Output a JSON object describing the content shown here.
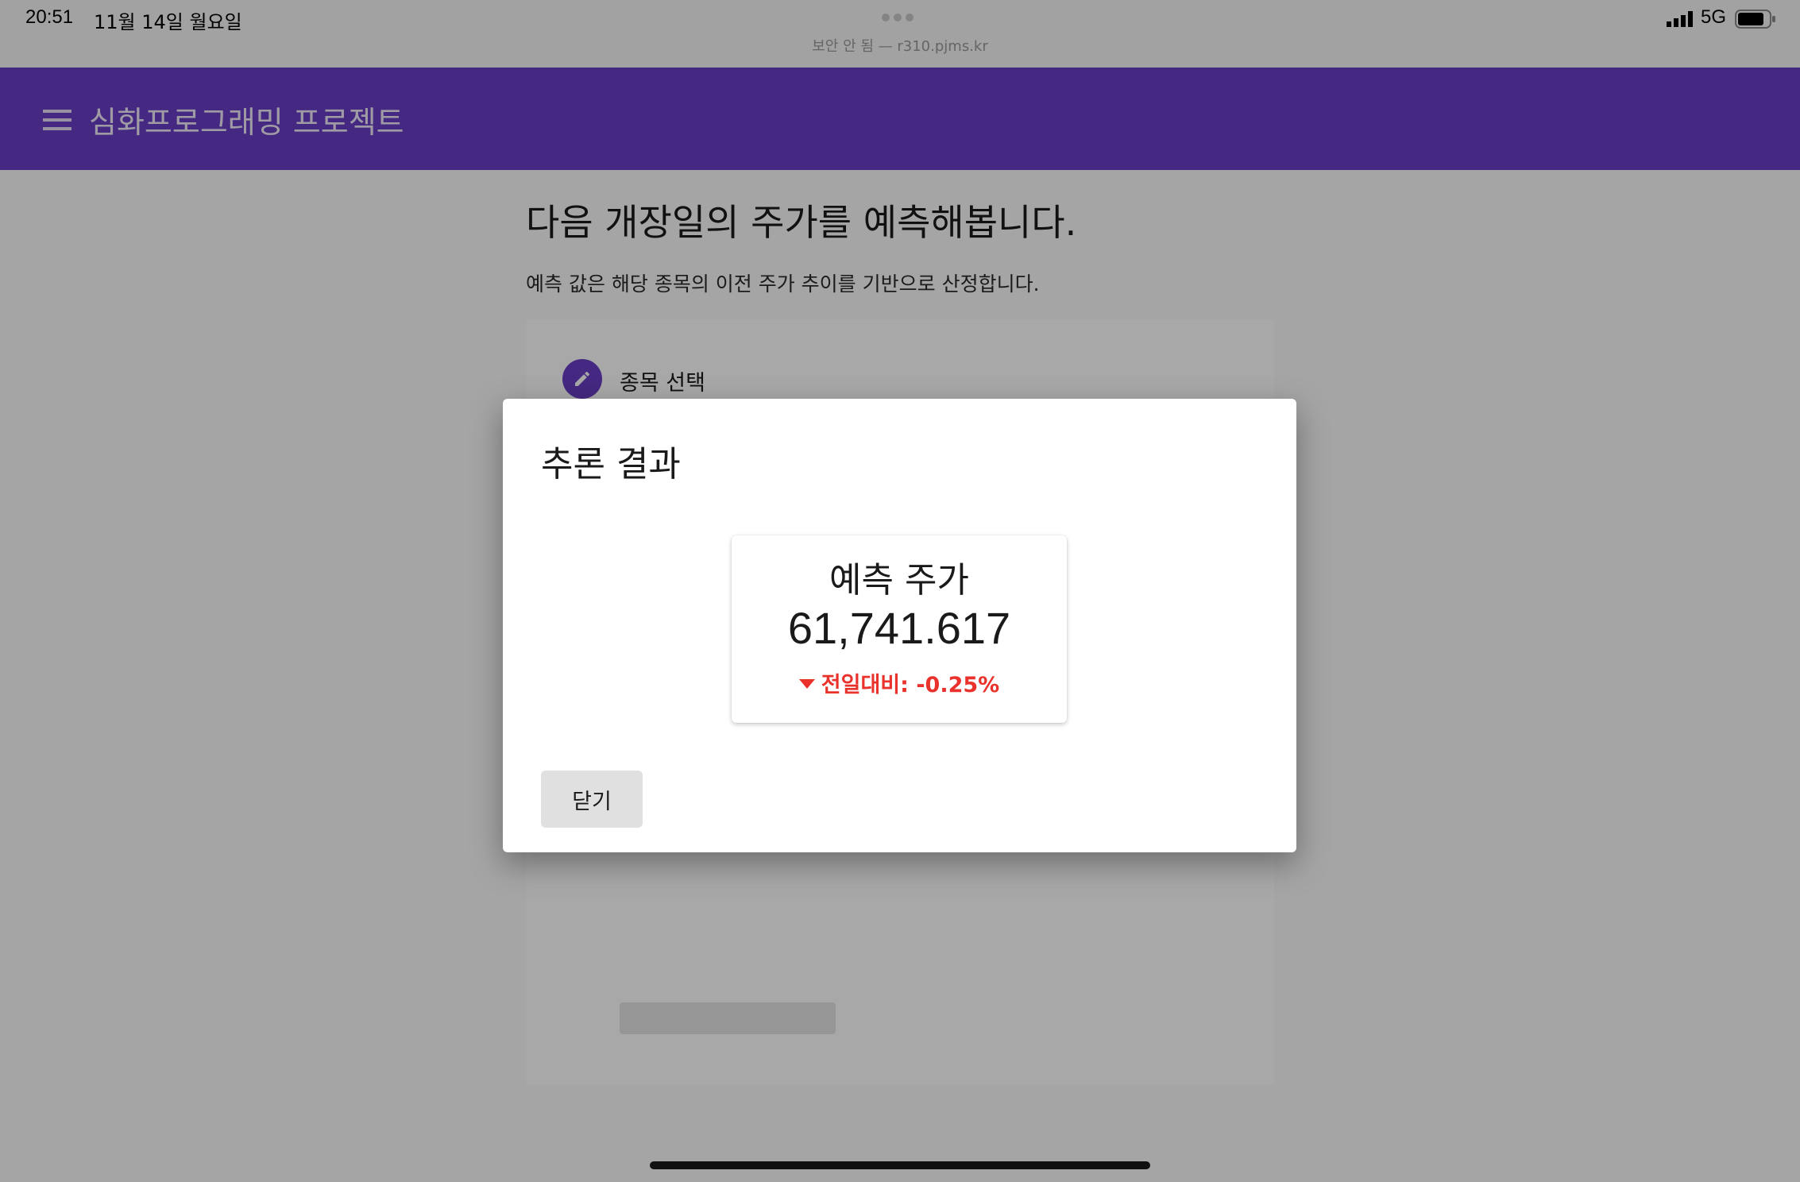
{
  "status_bar": {
    "time": "20:51",
    "date": "11월 14일 월요일",
    "url": "보안 안 됨 — r310.pjms.kr",
    "network": "5G",
    "icons": [
      "more-dots-icon",
      "signal-icon",
      "battery-icon"
    ]
  },
  "app_bar": {
    "title": "심화프로그래밍 프로젝트",
    "menu_icon": "menu-icon",
    "color": "#6a3ec6"
  },
  "page": {
    "heading": "다음 개장일의 주가를 예측해봅니다.",
    "description": "예측 값은 해당 종목의 이전 주가 추이를 기반으로 산정합니다.",
    "step": {
      "icon": "pencil-icon",
      "label": "종목 선택"
    }
  },
  "dialog": {
    "title": "추론 결과",
    "result": {
      "label": "예측 주가",
      "value": "61,741.617",
      "change_text": "전일대비: -0.25%",
      "change_icon": "triangle-down-icon",
      "change_color": "#e8322b"
    },
    "close_label": "닫기"
  }
}
